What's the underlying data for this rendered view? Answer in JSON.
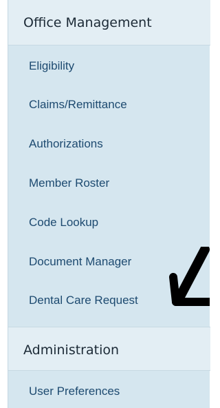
{
  "nav": {
    "sections": [
      {
        "title": "Office Management",
        "items": [
          "Eligibility",
          "Claims/Remittance",
          "Authorizations",
          "Member Roster",
          "Code Lookup",
          "Document Manager",
          "Dental Care Request"
        ]
      },
      {
        "title": "Administration",
        "items": [
          "User Preferences"
        ]
      }
    ]
  },
  "annotation": {
    "icon": "arrow-icon",
    "color": "#000000"
  }
}
